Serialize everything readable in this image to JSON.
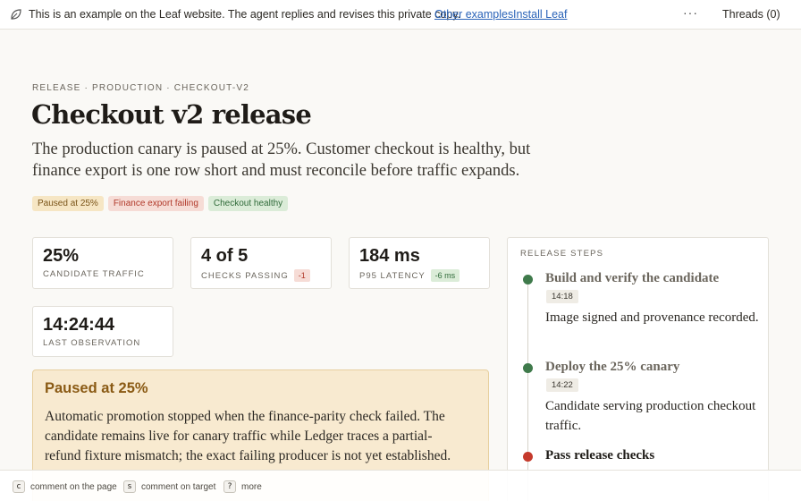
{
  "banner": {
    "icon": "leaf-icon",
    "text": "This is an example on the Leaf website. The agent replies and revises this private copy.",
    "link_examples": "Other examples",
    "link_install": "Install Leaf",
    "more": "···",
    "threads": "Threads (0)"
  },
  "header": {
    "breadcrumb": "RELEASE · PRODUCTION · CHECKOUT-V2",
    "title": "Checkout v2 release",
    "summary": "The production canary is paused at 25%. Customer checkout is healthy, but finance export is one row short and must reconcile before traffic expands.",
    "badges": [
      {
        "label": "Paused at 25%",
        "color": "#7a5418"
      },
      {
        "label": "Finance export failing",
        "color": "#b1392a"
      },
      {
        "label": "Checkout healthy",
        "color": "#2f6a39"
      }
    ]
  },
  "metrics": [
    {
      "value": "25%",
      "label": "CANDIDATE TRAFFIC",
      "delta": ""
    },
    {
      "value": "4 of 5",
      "label": "CHECKS PASSING",
      "delta": "-1"
    },
    {
      "value": "184 ms",
      "label": "P95 LATENCY",
      "delta": "-6 ms"
    },
    {
      "value": "14:24:44",
      "label": "LAST OBSERVATION",
      "delta": ""
    }
  ],
  "paused_panel": {
    "title": "Paused at 25%",
    "body": "Automatic promotion stopped when the finance-parity check failed. The candidate remains live for canary traffic while Ledger traces a partial-refund fixture mismatch; the exact failing producer is not yet established."
  },
  "release_steps": {
    "title": "RELEASE STEPS",
    "steps": [
      {
        "title": "Build and verify the candidate",
        "time": "14:18",
        "description": "Image signed and provenance recorded.",
        "status": "done"
      },
      {
        "title": "Deploy the 25% canary",
        "time": "14:22",
        "description": "Candidate serving production checkout traffic.",
        "status": "done"
      },
      {
        "title": "Pass release checks",
        "time": "",
        "description": "",
        "status": "failed"
      }
    ]
  },
  "shortcuts": [
    {
      "key": "c",
      "label": "comment on the page"
    },
    {
      "key": "s",
      "label": "comment on target"
    },
    {
      "key": "?",
      "label": "more"
    }
  ]
}
